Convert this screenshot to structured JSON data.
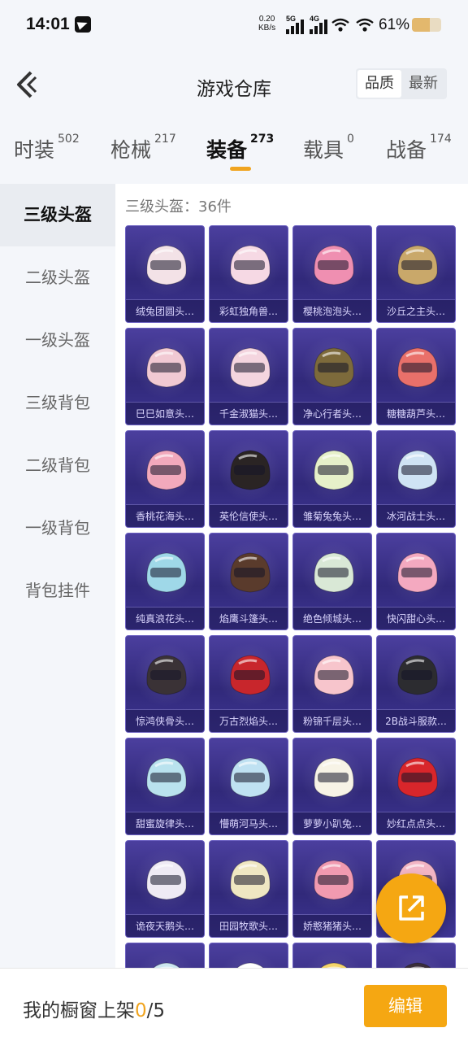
{
  "status_bar": {
    "time": "14:01",
    "net_speed": "0.20",
    "net_unit": "KB/s",
    "sim1": "5G",
    "sim2": "4G",
    "battery_pct": "61%",
    "battery_level": 0.61
  },
  "header": {
    "title": "游戏仓库",
    "sort_options": [
      "品质",
      "最新"
    ],
    "sort_selected": "品质"
  },
  "tabs": [
    {
      "label": "时装",
      "count": "502"
    },
    {
      "label": "枪械",
      "count": "217"
    },
    {
      "label": "装备",
      "count": "273"
    },
    {
      "label": "载具",
      "count": "0"
    },
    {
      "label": "战备",
      "count": "174"
    }
  ],
  "active_tab": "装备",
  "sidebar": {
    "items": [
      "三级头盔",
      "二级头盔",
      "一级头盔",
      "三级背包",
      "二级背包",
      "一级背包",
      "背包挂件"
    ],
    "active": "三级头盔"
  },
  "content": {
    "count_label": "三级头盔：36件",
    "items": [
      {
        "name": "绒兔团圆头…",
        "color": "#f3e2e7"
      },
      {
        "name": "彩虹独角兽…",
        "color": "#f6d9e4"
      },
      {
        "name": "樱桃泡泡头…",
        "color": "#ef8fb1"
      },
      {
        "name": "沙丘之主头…",
        "color": "#c9a86a"
      },
      {
        "name": "巳巳如意头…",
        "color": "#f1c9d3"
      },
      {
        "name": "千金淑猫头…",
        "color": "#f4d5df"
      },
      {
        "name": "净心行者头…",
        "color": "#7d6a3b"
      },
      {
        "name": "糖糖葫芦头…",
        "color": "#e9706a"
      },
      {
        "name": "香桃花海头…",
        "color": "#f2a9bc"
      },
      {
        "name": "英伦信使头…",
        "color": "#2a2424"
      },
      {
        "name": "雏菊兔兔头…",
        "color": "#e6f0c9"
      },
      {
        "name": "冰河战士头…",
        "color": "#cfe3f4"
      },
      {
        "name": "纯真浪花头…",
        "color": "#9fd8e8"
      },
      {
        "name": "焰鹰斗篷头…",
        "color": "#5a3b2c"
      },
      {
        "name": "绝色倾城头…",
        "color": "#d9e8d6"
      },
      {
        "name": "快闪甜心头…",
        "color": "#f4a9c0"
      },
      {
        "name": "惊鸿侠骨头…",
        "color": "#3a3236"
      },
      {
        "name": "万古烈焰头…",
        "color": "#c8262c"
      },
      {
        "name": "粉锦千层头…",
        "color": "#f7c5cc"
      },
      {
        "name": "2B战斗服款…",
        "color": "#2c2c30"
      },
      {
        "name": "甜蜜旋律头…",
        "color": "#b9e2ee"
      },
      {
        "name": "懵萌河马头…",
        "color": "#bfe1f2"
      },
      {
        "name": "萝萝小趴兔…",
        "color": "#f7f3e6"
      },
      {
        "name": "妙红点点头…",
        "color": "#d8262b"
      },
      {
        "name": "诡夜天鹅头…",
        "color": "#eeeaf4"
      },
      {
        "name": "田园牧歌头…",
        "color": "#efe7c2"
      },
      {
        "name": "娇憨猪猪头…",
        "color": "#f19ab0"
      },
      {
        "name": "",
        "color": "#f2b5c4"
      },
      {
        "name": "",
        "color": "#cde6f0"
      },
      {
        "name": "",
        "color": "#ffffff"
      },
      {
        "name": "",
        "color": "#f5d56a"
      },
      {
        "name": "",
        "color": "#3a2e3a"
      }
    ]
  },
  "bottom_bar": {
    "label_prefix": "我的橱窗上架",
    "shelf_count": "0",
    "shelf_total": "/5",
    "edit_label": "编辑"
  }
}
